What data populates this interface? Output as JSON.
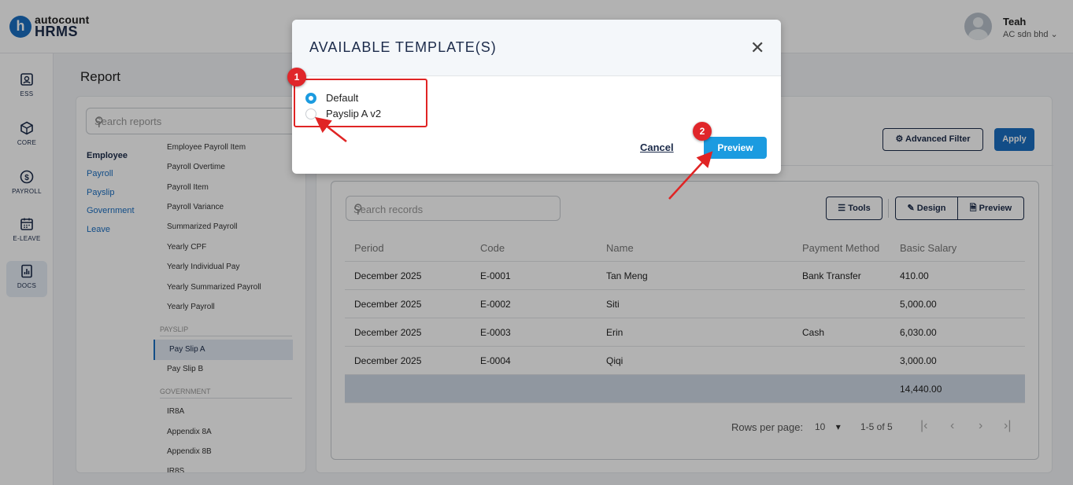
{
  "app": {
    "logo_letter": "h",
    "logo_top": "autocount",
    "logo_bottom": "HRMS",
    "user_name": "Teah",
    "company": "AC sdn bhd ⌄"
  },
  "nav": [
    {
      "label": "ESS",
      "icon": "person-badge-icon"
    },
    {
      "label": "CORE",
      "icon": "cube-icon"
    },
    {
      "label": "PAYROLL",
      "icon": "dollar-icon"
    },
    {
      "label": "E-LEAVE",
      "icon": "calendar-icon"
    },
    {
      "label": "DOCS",
      "icon": "chart-doc-icon"
    }
  ],
  "page": {
    "title": "Report",
    "search_placeholder": "Search reports"
  },
  "categories": [
    "Employee",
    "Payroll",
    "Payslip",
    "Government",
    "Leave"
  ],
  "reports": {
    "payroll": [
      "Employee Payroll Item",
      "Payroll Overtime",
      "Payroll Item",
      "Payroll Variance",
      "Summarized Payroll",
      "Yearly CPF",
      "Yearly Individual Pay",
      "Yearly Summarized Payroll",
      "Yearly Payroll"
    ],
    "payslip_section": "PAYSLIP",
    "payslip": [
      "Pay Slip A",
      "Pay Slip B"
    ],
    "government_section": "GOVERNMENT",
    "government": [
      "IR8A",
      "Appendix 8A",
      "Appendix 8B",
      "IR8S"
    ]
  },
  "filters": {
    "advanced": "Advanced Filter",
    "apply": "Apply"
  },
  "grid": {
    "search_placeholder": "Search records",
    "tools": "Tools",
    "design": "Design",
    "preview": "Preview",
    "columns": [
      "Period",
      "Code",
      "Name",
      "Payment Method",
      "Basic Salary"
    ],
    "rows": [
      [
        "December 2025",
        "E-0001",
        "Tan Meng",
        "Bank Transfer",
        "410.00"
      ],
      [
        "December 2025",
        "E-0002",
        "Siti",
        "",
        "5,000.00"
      ],
      [
        "December 2025",
        "E-0003",
        "Erin",
        "Cash",
        "6,030.00"
      ],
      [
        "December 2025",
        "E-0004",
        "Qiqi",
        "",
        "3,000.00"
      ]
    ],
    "total": "14,440.00",
    "rows_per_page_label": "Rows per page:",
    "rows_per_page": "10",
    "range": "1-5 of 5"
  },
  "modal": {
    "title": "AVAILABLE TEMPLATE(S)",
    "options": [
      {
        "label": "Default",
        "selected": true
      },
      {
        "label": "Payslip A v2",
        "selected": false
      }
    ],
    "cancel": "Cancel",
    "preview": "Preview"
  },
  "annotations": {
    "step1": "1",
    "step2": "2",
    "color": "#e02424"
  }
}
